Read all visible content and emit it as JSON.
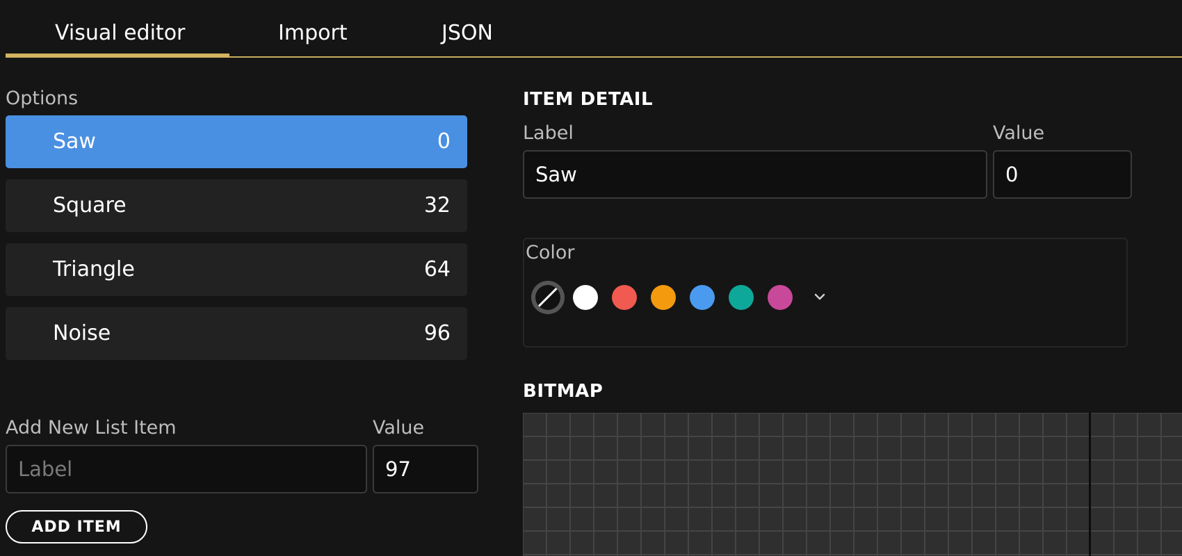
{
  "tabs": [
    {
      "label": "Visual editor",
      "active": true
    },
    {
      "label": "Import",
      "active": false
    },
    {
      "label": "JSON",
      "active": false
    }
  ],
  "options": {
    "heading": "Options",
    "items": [
      {
        "label": "Saw",
        "value": "0",
        "selected": true
      },
      {
        "label": "Square",
        "value": "32",
        "selected": false
      },
      {
        "label": "Triangle",
        "value": "64",
        "selected": false
      },
      {
        "label": "Noise",
        "value": "96",
        "selected": false
      }
    ]
  },
  "add_item": {
    "label_heading": "Add New List Item",
    "value_heading": "Value",
    "label_placeholder": "Label",
    "value": "97",
    "button_label": "ADD ITEM"
  },
  "item_detail": {
    "heading": "ITEM DETAIL",
    "label_heading": "Label",
    "value_heading": "Value",
    "label_value": "Saw",
    "value_value": "0"
  },
  "color": {
    "heading": "Color",
    "swatches": [
      "none",
      "#ffffff",
      "#f05a50",
      "#f39a0f",
      "#4a9aef",
      "#0ea89a",
      "#c8489a"
    ]
  },
  "bitmap": {
    "heading": "BITMAP"
  },
  "colors": {
    "accent": "#d2b35f",
    "selected": "#4a90e2"
  }
}
